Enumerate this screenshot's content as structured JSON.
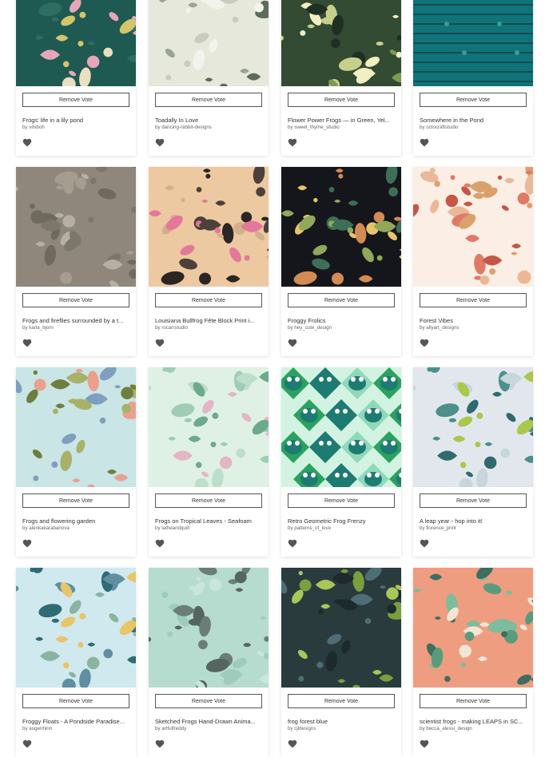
{
  "remove_vote_label": "Remove Vote",
  "cards": [
    {
      "title": "Frogs' life in a lily pond",
      "byline": "by vihiboh",
      "art": "lilypond",
      "colors": [
        "#1f5a52",
        "#2e6e62",
        "#d4c46a",
        "#e7a6b8",
        "#e8e0c0"
      ]
    },
    {
      "title": "Toadally In Love",
      "byline": "by dancing-rabbit-designs",
      "art": "sketch",
      "colors": [
        "#e6e8dc",
        "#5c6c5a",
        "#c8ccbc",
        "#9aa492",
        "#f2f3ec"
      ]
    },
    {
      "title": "Flower Power Frogs — in Green, Yel...",
      "byline": "by sweet_thyme_studio",
      "art": "flowerpower",
      "colors": [
        "#334a33",
        "#c6d08c",
        "#f2efc2",
        "#7f9a4e",
        "#1f2f24"
      ]
    },
    {
      "title": "Somewhere in the Pond",
      "byline": "by octocraftstudio",
      "art": "stripes",
      "colors": [
        "#0e7479",
        "#0a5d63",
        "#1a3c44",
        "#3a9a9c",
        "#094a50"
      ]
    },
    {
      "title": "Frogs and fireflies surrounded by a t...",
      "byline": "by karla_bjorn",
      "art": "leafy",
      "colors": [
        "#8f877b",
        "#a49d90",
        "#7d766a",
        "#b6b0a3",
        "#6f695e"
      ]
    },
    {
      "title": "Louisiana Bullfrog Fête Block Print i...",
      "byline": "by rocarrstudio",
      "art": "blockprint",
      "colors": [
        "#edc9a2",
        "#2b2624",
        "#e3789a",
        "#d1b08c",
        "#4b413a"
      ]
    },
    {
      "title": "Froggy Frolics",
      "byline": "by hey_cute_design",
      "art": "darkfloral",
      "colors": [
        "#15161b",
        "#d28b53",
        "#8fa85c",
        "#e7c36a",
        "#3d6e56"
      ]
    },
    {
      "title": "Forest Vibes",
      "byline": "by allyart_designs",
      "art": "mushrooms",
      "colors": [
        "#fbeee4",
        "#e07a67",
        "#d9a16c",
        "#c45746",
        "#eab899"
      ]
    },
    {
      "title": "Frogs and flowering garden",
      "byline": "by alenkakarabanova",
      "art": "garden",
      "colors": [
        "#c9e5e6",
        "#eba08f",
        "#7e9fbd",
        "#6f7e3c",
        "#a7b168"
      ]
    },
    {
      "title": "Frogs on Tropical Leaves - Seafoam",
      "byline": "by latheandquill",
      "art": "tropical",
      "colors": [
        "#dff1e5",
        "#9fcdb4",
        "#6fa98d",
        "#e3b6c7",
        "#bcdfcb"
      ]
    },
    {
      "title": "Retro Geometric Frog Frenzy",
      "byline": "by patterns_of_love",
      "art": "geometric",
      "colors": [
        "#2aa25e",
        "#1d7b72",
        "#8fd9b8",
        "#d2f3e2",
        "#1a5a4e"
      ]
    },
    {
      "title": "A leap year - hop into it!",
      "byline": "by florence_print",
      "art": "monstera",
      "colors": [
        "#e2e7ee",
        "#4c8f8b",
        "#a9c84c",
        "#2f6b6e",
        "#c6d6db"
      ]
    },
    {
      "title": "Froggy Floats - A Pondside Paradise...",
      "byline": "by augenhinn",
      "art": "pondside",
      "colors": [
        "#cfe9ee",
        "#2f6b74",
        "#e8c567",
        "#8bb4a0",
        "#5f8fa0"
      ]
    },
    {
      "title": "Sketched Frogs Hand-Drawn Anima...",
      "byline": "by artfulfreddy",
      "art": "sketchfrogs",
      "colors": [
        "#b6dbcf",
        "#54665f",
        "#9fcbbd",
        "#c8e6dc",
        "#6b7d75"
      ]
    },
    {
      "title": "frog forest blue",
      "byline": "by cjldesigns",
      "art": "forest",
      "colors": [
        "#2a3b3e",
        "#7a9f3d",
        "#4d6e74",
        "#a9c659",
        "#1c2a2c"
      ]
    },
    {
      "title": "scientist frogs - making LEAPS in SC...",
      "byline": "by becca_alessi_design",
      "art": "science",
      "colors": [
        "#ee9d80",
        "#7bbd9c",
        "#3f6d62",
        "#f2e7d6",
        "#5a9b7e"
      ]
    }
  ]
}
